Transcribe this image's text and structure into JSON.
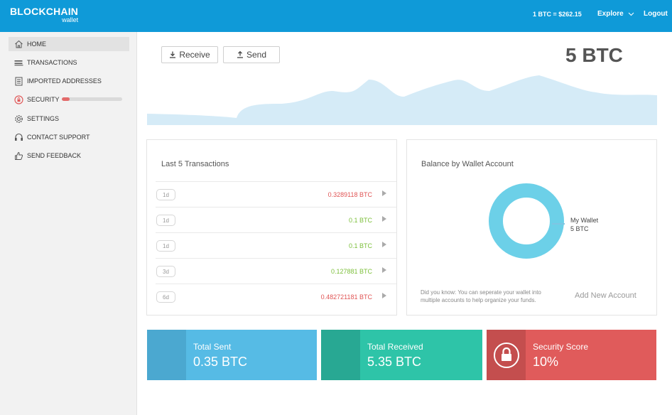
{
  "header": {
    "logo_main": "BLOCKCHAIN",
    "logo_sub": "wallet",
    "price": "1 BTC = $262.15",
    "explore": "Explore",
    "logout": "Logout",
    "colors": {
      "bar": "#0f9ad8"
    }
  },
  "sidebar": {
    "items": [
      {
        "label": "HOME",
        "icon": "home-icon"
      },
      {
        "label": "TRANSACTIONS",
        "icon": "transactions-icon"
      },
      {
        "label": "IMPORTED ADDRESSES",
        "icon": "imported-addresses-icon"
      },
      {
        "label": "SECURITY",
        "icon": "lock-icon",
        "progress": 0.13
      },
      {
        "label": "SETTINGS",
        "icon": "gear-icon"
      },
      {
        "label": "CONTACT SUPPORT",
        "icon": "headphones-icon"
      },
      {
        "label": "SEND FEEDBACK",
        "icon": "thumbs-up-icon"
      }
    ],
    "active_index": 0
  },
  "actions": {
    "receive": "Receive",
    "send": "Send"
  },
  "balance": "5 BTC",
  "transactions": {
    "title": "Last 5 Transactions",
    "rows": [
      {
        "age": "1d",
        "amount": "0.3289118 BTC",
        "direction": "sent"
      },
      {
        "age": "1d",
        "amount": "0.1 BTC",
        "direction": "received"
      },
      {
        "age": "1d",
        "amount": "0.1 BTC",
        "direction": "received"
      },
      {
        "age": "3d",
        "amount": "0.127881 BTC",
        "direction": "received"
      },
      {
        "age": "6d",
        "amount": "0.482721181 BTC",
        "direction": "sent"
      }
    ]
  },
  "accounts": {
    "title": "Balance by Wallet Account",
    "wallet_name": "My Wallet",
    "wallet_balance": "5 BTC",
    "tip": "Did you know: You can seperate your wallet into multiple accounts to help organize your funds.",
    "add_account": "Add New Account",
    "colors": {
      "donut": "#6cd0e8"
    }
  },
  "stats": {
    "total_sent": {
      "label": "Total Sent",
      "value": "0.35 BTC",
      "color": "#56bbe5",
      "accent": "#4ba8d0"
    },
    "total_received": {
      "label": "Total Received",
      "value": "5.35 BTC",
      "color": "#2ec4a8",
      "accent": "#28a893"
    },
    "security_score": {
      "label": "Security Score",
      "value": "10%",
      "color": "#e05b5b",
      "accent": "#c44e4e"
    }
  }
}
